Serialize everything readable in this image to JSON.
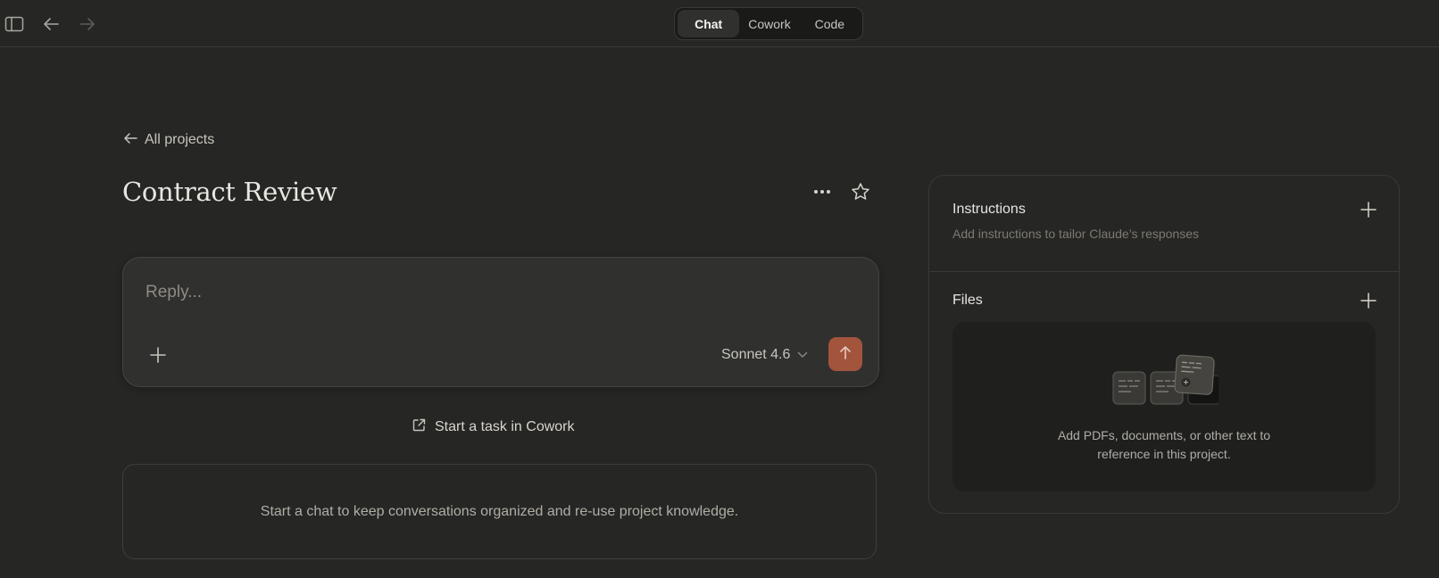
{
  "topbar": {
    "sidebar_toggle_icon": "sidebar-icon",
    "back_icon": "arrow-left-icon",
    "forward_icon": "arrow-right-icon",
    "tabs": [
      {
        "label": "Chat",
        "active": true
      },
      {
        "label": "Cowork",
        "active": false
      },
      {
        "label": "Code",
        "active": false
      }
    ]
  },
  "header": {
    "back_link": "All projects",
    "title": "Contract Review",
    "more_icon": "ellipsis-icon",
    "star_icon": "star-icon"
  },
  "composer": {
    "placeholder": "Reply...",
    "model": "Sonnet 4.6",
    "send_color": "#a2543d"
  },
  "cowork_link": "Start a task in Cowork",
  "empty_state": "Start a chat to keep conversations organized and re-use project knowledge.",
  "side_panel": {
    "instructions": {
      "title": "Instructions",
      "subtitle": "Add instructions to tailor Claude’s responses"
    },
    "files": {
      "title": "Files",
      "empty_line1": "Add PDFs, documents, or other text to",
      "empty_line2": "reference in this project."
    }
  }
}
